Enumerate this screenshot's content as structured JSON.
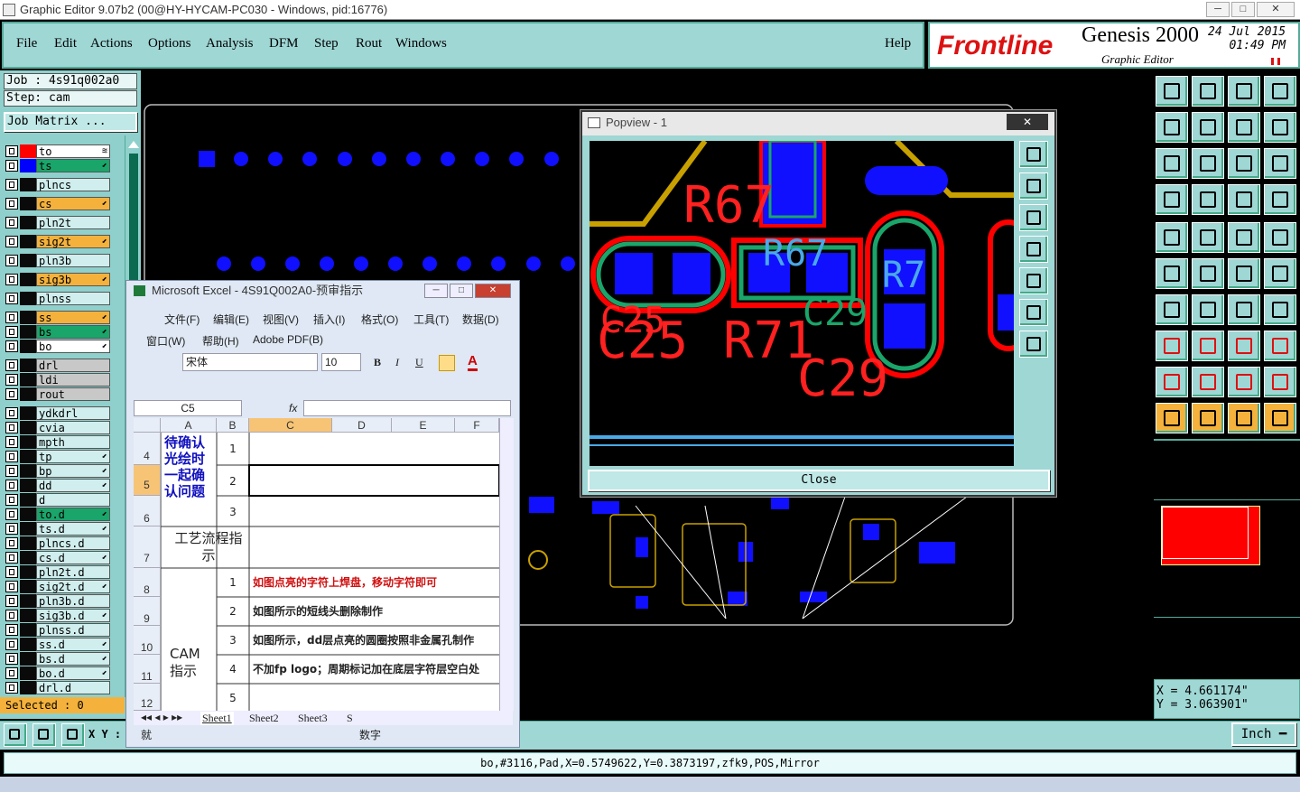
{
  "window": {
    "title": "Graphic Editor 9.07b2 (00@HY-HYCAM-PC030 - Windows, pid:16776)",
    "controls": [
      "─",
      "□",
      "✕"
    ]
  },
  "menu": [
    "File",
    "Edit",
    "Actions",
    "Options",
    "Analysis",
    "DFM",
    "Step",
    "Rout",
    "Windows"
  ],
  "help": "Help",
  "brand": {
    "logo": "Frontline",
    "product": "Genesis 2000",
    "subtitle": "Graphic Editor",
    "date": "24 Jul 2015",
    "time": "01:49 PM"
  },
  "job": {
    "job": "Job : 4s91q002a0",
    "step": "Step: cam",
    "matrix": "Job Matrix ..."
  },
  "layers": [
    {
      "name": "to",
      "color": "#ffffff",
      "mark": "≋",
      "swatch": "#ff0000"
    },
    {
      "name": "ts",
      "color": "#1aa56a",
      "mark": "⬋",
      "swatch": "#0000ff"
    },
    {
      "name": "plncs",
      "color": "#cfeeed",
      "mark": "",
      "swatch": ""
    },
    {
      "name": "cs",
      "color": "#f4b23c",
      "mark": "⬋",
      "swatch": ""
    },
    {
      "name": "pln2t",
      "color": "#cfeeed",
      "mark": "",
      "swatch": ""
    },
    {
      "name": "sig2t",
      "color": "#f4b23c",
      "mark": "⬋",
      "swatch": ""
    },
    {
      "name": "pln3b",
      "color": "#cfeeed",
      "mark": "",
      "swatch": ""
    },
    {
      "name": "sig3b",
      "color": "#f4b23c",
      "mark": "⬋",
      "swatch": ""
    },
    {
      "name": "plnss",
      "color": "#cfeeed",
      "mark": "",
      "swatch": ""
    },
    {
      "name": "ss",
      "color": "#f4b23c",
      "mark": "⬋",
      "swatch": ""
    },
    {
      "name": "bs",
      "color": "#1aa56a",
      "mark": "⬋",
      "swatch": ""
    },
    {
      "name": "bo",
      "color": "#ffffff",
      "mark": "⬋",
      "swatch": ""
    },
    {
      "name": "drl",
      "color": "#c8c8c8",
      "mark": "",
      "swatch": ""
    },
    {
      "name": "ldi",
      "color": "#c8c8c8",
      "mark": "",
      "swatch": ""
    },
    {
      "name": "rout",
      "color": "#c8c8c8",
      "mark": "",
      "swatch": ""
    },
    {
      "name": "ydkdrl",
      "color": "#cfeeed",
      "mark": "",
      "swatch": ""
    },
    {
      "name": "cvia",
      "color": "#cfeeed",
      "mark": "",
      "swatch": ""
    },
    {
      "name": "mpth",
      "color": "#cfeeed",
      "mark": "",
      "swatch": ""
    },
    {
      "name": "tp",
      "color": "#cfeeed",
      "mark": "⬋",
      "swatch": ""
    },
    {
      "name": "bp",
      "color": "#cfeeed",
      "mark": "⬋",
      "swatch": ""
    },
    {
      "name": "dd",
      "color": "#cfeeed",
      "mark": "⬋",
      "swatch": ""
    },
    {
      "name": "d",
      "color": "#cfeeed",
      "mark": "",
      "swatch": ""
    },
    {
      "name": "to.d",
      "color": "#1aa56a",
      "mark": "⬋",
      "swatch": ""
    },
    {
      "name": "ts.d",
      "color": "#cfeeed",
      "mark": "⬋",
      "swatch": ""
    },
    {
      "name": "plncs.d",
      "color": "#cfeeed",
      "mark": "",
      "swatch": ""
    },
    {
      "name": "cs.d",
      "color": "#cfeeed",
      "mark": "⬋",
      "swatch": ""
    },
    {
      "name": "pln2t.d",
      "color": "#cfeeed",
      "mark": "",
      "swatch": ""
    },
    {
      "name": "sig2t.d",
      "color": "#cfeeed",
      "mark": "⬋",
      "swatch": ""
    },
    {
      "name": "pln3b.d",
      "color": "#cfeeed",
      "mark": "",
      "swatch": ""
    },
    {
      "name": "sig3b.d",
      "color": "#cfeeed",
      "mark": "⬋",
      "swatch": ""
    },
    {
      "name": "plnss.d",
      "color": "#cfeeed",
      "mark": "",
      "swatch": ""
    },
    {
      "name": "ss.d",
      "color": "#cfeeed",
      "mark": "⬋",
      "swatch": ""
    },
    {
      "name": "bs.d",
      "color": "#cfeeed",
      "mark": "⬋",
      "swatch": ""
    },
    {
      "name": "bo.d",
      "color": "#cfeeed",
      "mark": "⬋",
      "swatch": ""
    },
    {
      "name": "drl.d",
      "color": "#cfeeed",
      "mark": "",
      "swatch": ""
    }
  ],
  "selected": "Selected : 0",
  "coords": {
    "x": "X = 4.661174\"",
    "y": "Y = 3.063901\""
  },
  "bottombar": {
    "xy_label": "X Y :",
    "unit": "Inch"
  },
  "status": "bo,#3116,Pad,X=0.5749622,Y=0.3873197,zfk9,POS,Mirror",
  "popview": {
    "title": "Popview - 1",
    "close": "Close",
    "close_x": "✕",
    "labels": [
      "R67",
      "R67",
      "R7",
      "C25",
      "C25",
      "R71",
      "C29",
      "C29"
    ]
  },
  "excel": {
    "title": "Microsoft Excel - 4S91Q002A0-预审指示",
    "menu1": [
      "文件(F)",
      "编辑(E)",
      "视图(V)",
      "插入(I)",
      "格式(O)",
      "工具(T)",
      "数据(D)"
    ],
    "menu2": [
      "窗口(W)",
      "帮助(H)",
      "Adobe PDF(B)"
    ],
    "font": "宋体",
    "size": "10",
    "namebox": "C5",
    "fx": "fx",
    "cols": [
      "A",
      "B",
      "C",
      "D",
      "E",
      "F"
    ],
    "rows": [
      "4",
      "5",
      "6",
      "7",
      "8",
      "9",
      "10",
      "11",
      "12"
    ],
    "group1": "待确认光绘时一起确认问题",
    "group2": "工艺流程指示",
    "group3": "CAM指示",
    "nums": [
      "1",
      "2",
      "3",
      "1",
      "2",
      "3",
      "4",
      "5"
    ],
    "notes": [
      "如图点亮的字符上焊盘，移动字符即可",
      "如图所示的短线头删除制作",
      "如图所示，dd层点亮的圆圈按照非金属孔制作",
      "不加fp logo；周期标记加在底层字符层空白处"
    ],
    "sheets": [
      "Sheet1",
      "Sheet2",
      "Sheet3",
      "S"
    ],
    "status_left": "就",
    "status_mid": "数字"
  }
}
